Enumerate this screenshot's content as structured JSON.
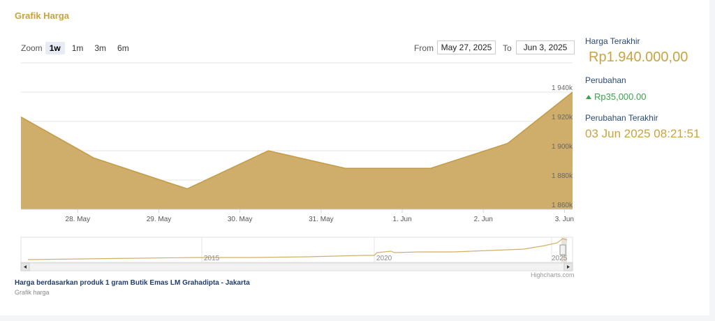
{
  "header": {
    "title": "Grafik Harga"
  },
  "zoom": {
    "label": "Zoom",
    "buttons": [
      "1w",
      "1m",
      "3m",
      "6m"
    ],
    "active": "1w"
  },
  "range": {
    "from_label": "From",
    "from_value": "May 27, 2025",
    "to_label": "To",
    "to_value": "Jun 3, 2025"
  },
  "side": {
    "last_price_label": "Harga Terakhir",
    "last_price_value": "Rp1.940.000,00",
    "change_label": "Perubahan",
    "change_value": "Rp35,000.00",
    "last_change_label": "Perubahan Terakhir",
    "last_change_value": "03 Jun 2025 08:21:51"
  },
  "navigator": {
    "labels": [
      "2015",
      "2020",
      "2025"
    ]
  },
  "caption": "Harga berdasarkan produk 1 gram Butik Emas LM Grahadipta - Jakarta",
  "subcaption": "Grafik harga",
  "credits": "Highcharts.com",
  "colors": {
    "accent": "#c9a340",
    "fill": "#cfae6c",
    "line": "#c49a45",
    "up": "#3ca44a"
  },
  "chart_data": {
    "type": "area",
    "x": [
      27.3,
      28.2,
      29.35,
      30.35,
      31.3,
      32.35,
      33.3,
      34.1
    ],
    "values": [
      1923,
      1895,
      1874,
      1900,
      1888,
      1888,
      1905,
      1940
    ],
    "x_ticks": [
      {
        "pos": 28,
        "label": "28. May"
      },
      {
        "pos": 29,
        "label": "29. May"
      },
      {
        "pos": 30,
        "label": "30. May"
      },
      {
        "pos": 31,
        "label": "31. May"
      },
      {
        "pos": 32,
        "label": "1. Jun"
      },
      {
        "pos": 33,
        "label": "2. Jun"
      },
      {
        "pos": 34,
        "label": "3. Jun"
      }
    ],
    "y_ticks": [
      {
        "value": 1860,
        "label": "1 860k"
      },
      {
        "value": 1880,
        "label": "1 880k"
      },
      {
        "value": 1900,
        "label": "1 900k"
      },
      {
        "value": 1920,
        "label": "1 920k"
      },
      {
        "value": 1940,
        "label": "1 940k"
      }
    ],
    "xlim": [
      27.3,
      34.1
    ],
    "ylim": [
      1860,
      1960
    ],
    "grid": true,
    "legend": "none"
  }
}
